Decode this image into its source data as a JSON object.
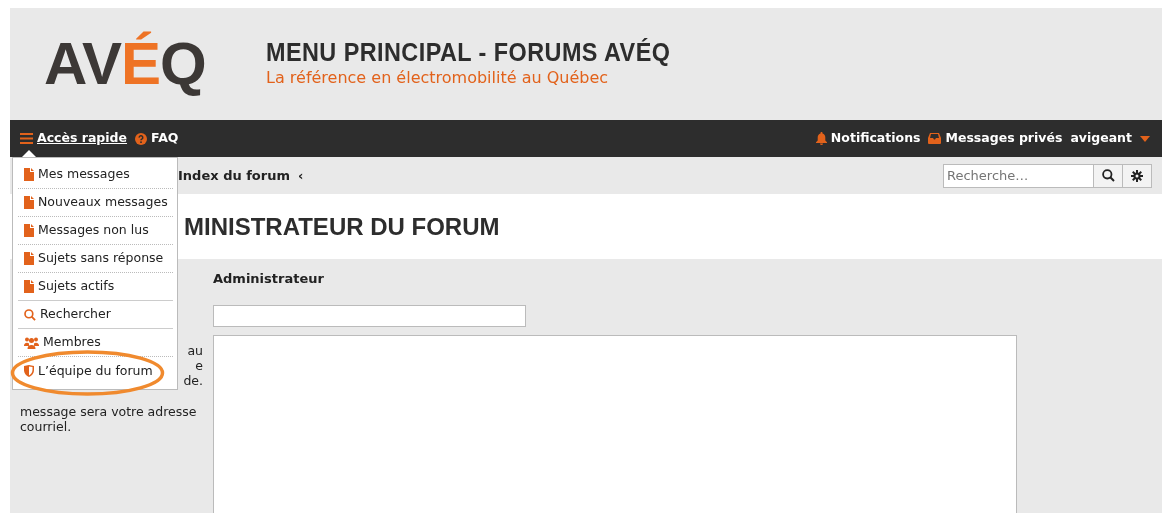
{
  "header": {
    "logo": "AVÉQ",
    "title": "MENU PRINCIPAL - FORUMS AVÉQ",
    "tagline": "La référence en électromobilité au Québec"
  },
  "navbar": {
    "quick_access": "Accès rapide",
    "faq": "FAQ",
    "notifications": "Notifications",
    "private_messages": "Messages privés",
    "username": "avigeant"
  },
  "quick_menu": {
    "expanded": true,
    "items": [
      {
        "kind": "file",
        "label": "Mes messages"
      },
      {
        "kind": "file",
        "label": "Nouveaux messages"
      },
      {
        "kind": "file",
        "label": "Messages non lus"
      },
      {
        "kind": "file",
        "label": "Sujets sans réponse"
      },
      {
        "kind": "file",
        "label": "Sujets actifs"
      },
      {
        "kind": "search",
        "label": "Rechercher"
      },
      {
        "kind": "members",
        "label": "Membres"
      },
      {
        "kind": "shield",
        "label": "L’équipe du forum",
        "highlighted": true
      }
    ]
  },
  "breadcrumb": {
    "items": [
      "Index du forum"
    ],
    "separator": "‹"
  },
  "search": {
    "placeholder": "Recherche…"
  },
  "page_title": "MINISTRATEUR DU FORUM",
  "help_fragments": [
    "au",
    "e",
    "de."
  ],
  "help_text": "message sera votre adresse courriel.",
  "form": {
    "label": "Administrateur"
  }
}
